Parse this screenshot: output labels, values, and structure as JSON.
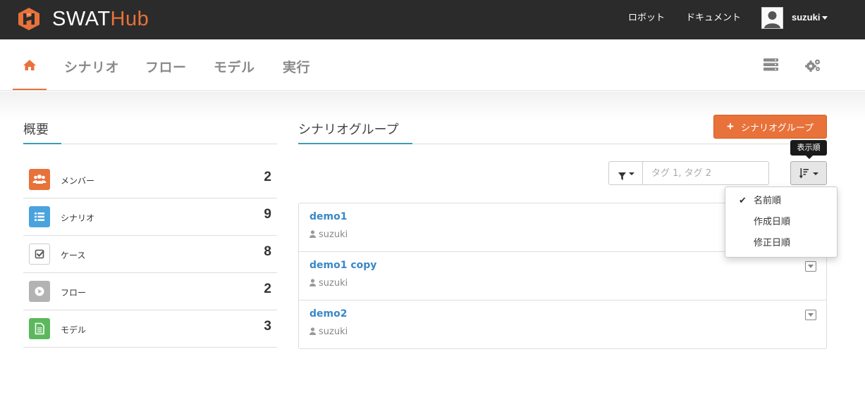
{
  "app": {
    "logo_left": "SWAT",
    "logo_right": "Hub",
    "brand_color": "#e8723a"
  },
  "topnav": {
    "links": [
      "ロボット",
      "ドキュメント"
    ],
    "user_name": "suzuki"
  },
  "subnav": {
    "home_icon": "home-icon",
    "tabs": [
      "シナリオ",
      "フロー",
      "モデル",
      "実行"
    ],
    "right_icons": [
      "server-icon",
      "cogs-icon"
    ]
  },
  "overview": {
    "title": "概要",
    "stats": [
      {
        "icon": "users-icon",
        "color": "#e8723a",
        "label": "メンバー",
        "value": "2"
      },
      {
        "icon": "list-icon",
        "color": "#4aa3df",
        "label": "シナリオ",
        "value": "9"
      },
      {
        "icon": "check-square-icon",
        "color": "#ffffff",
        "label": "ケース",
        "value": "8"
      },
      {
        "icon": "play-circle-icon",
        "color": "#b3b3b3",
        "label": "フロー",
        "value": "2"
      },
      {
        "icon": "file-text-icon",
        "color": "#5cb85c",
        "label": "モデル",
        "value": "3"
      }
    ]
  },
  "scenario_groups": {
    "title": "シナリオグループ",
    "add_button": "シナリオグループ",
    "sort_tooltip": "表示順",
    "tag_placeholder": "タグ 1, タグ 2",
    "sort_options": [
      {
        "label": "名前順",
        "selected": true
      },
      {
        "label": "作成日順",
        "selected": false
      },
      {
        "label": "修正日順",
        "selected": false
      }
    ],
    "items": [
      {
        "name": "demo1",
        "owner": "suzuki"
      },
      {
        "name": "demo1 copy",
        "owner": "suzuki"
      },
      {
        "name": "demo2",
        "owner": "suzuki"
      }
    ]
  }
}
